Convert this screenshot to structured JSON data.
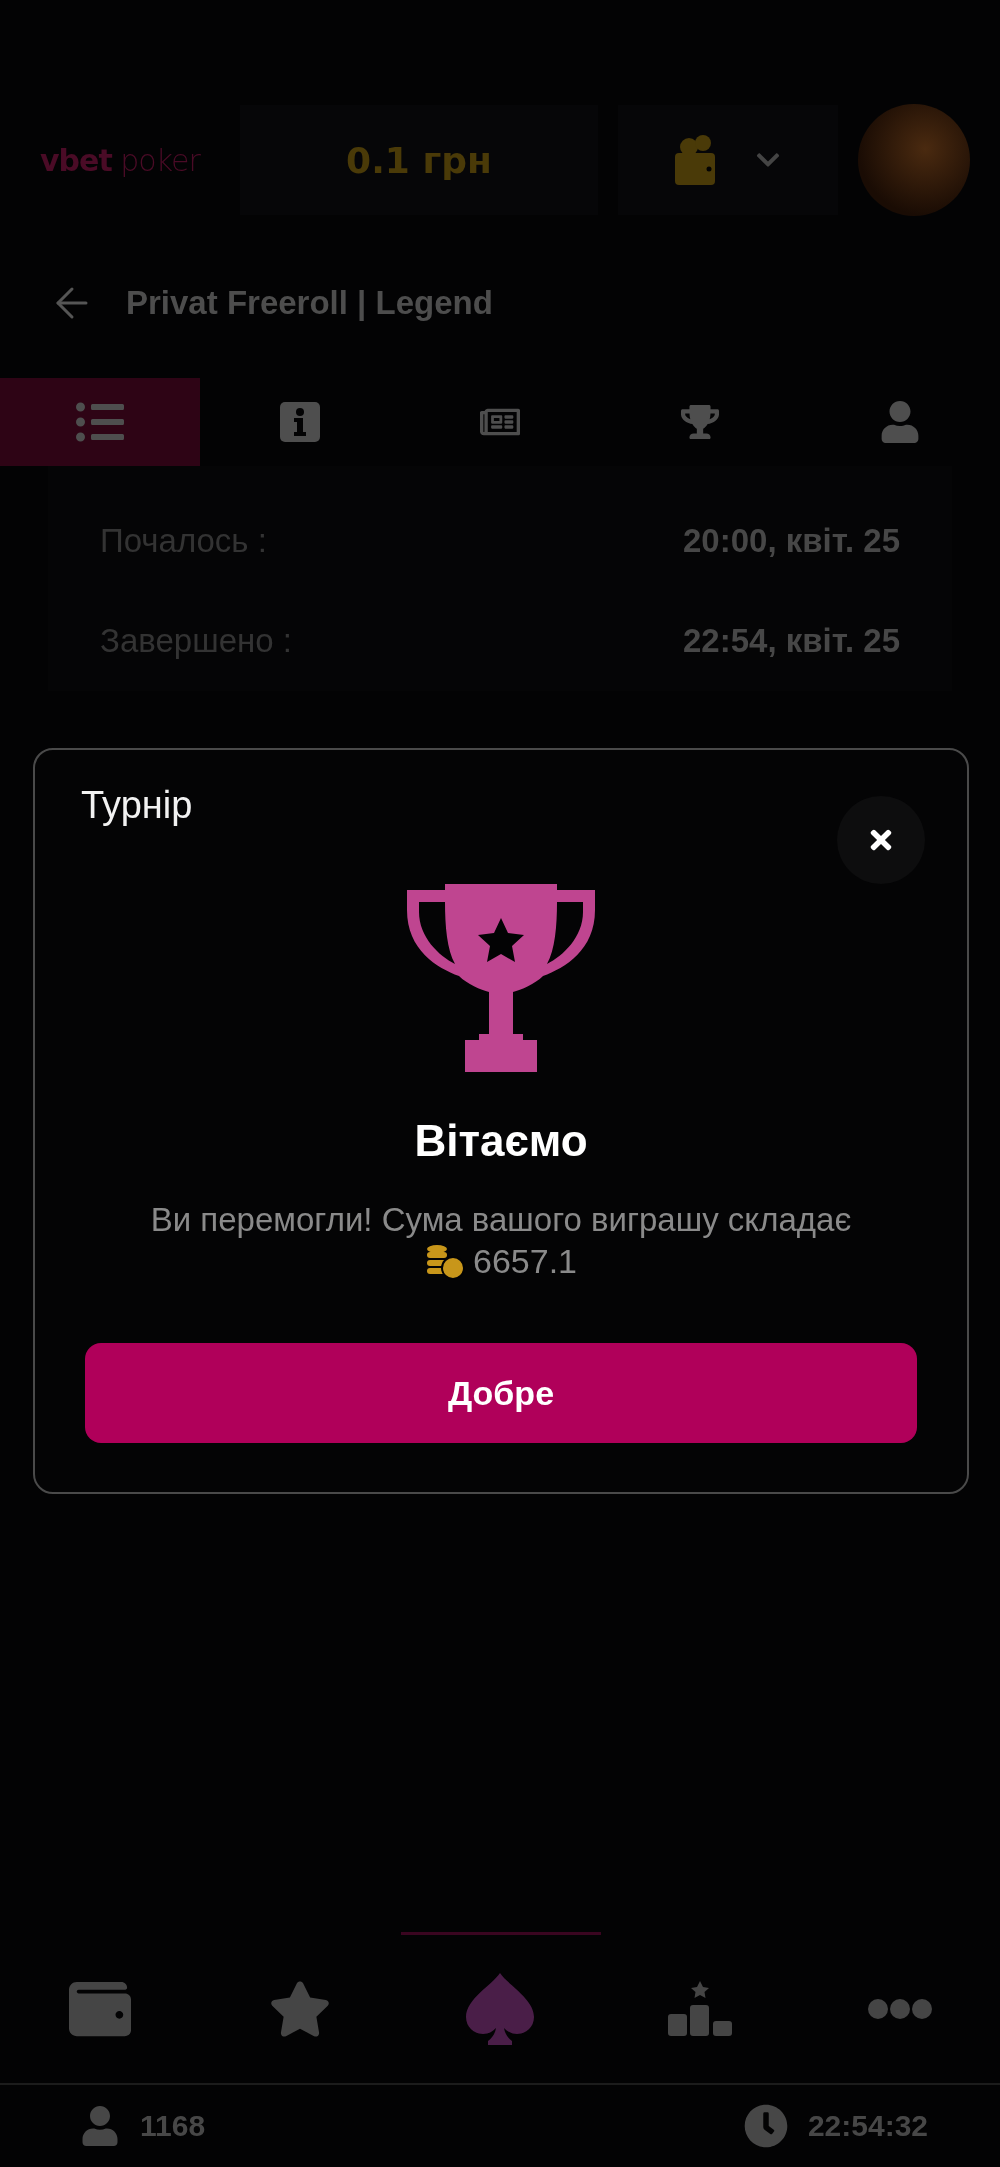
{
  "header": {
    "logo": {
      "brand": "vbet",
      "product": "poker"
    },
    "balance": "0.1 грн"
  },
  "page_title": "Privat Freeroll | Legend",
  "tabs": [
    {
      "kind": "list",
      "selected": true
    },
    {
      "kind": "info",
      "selected": false
    },
    {
      "kind": "card",
      "selected": false
    },
    {
      "kind": "trophy",
      "selected": false
    },
    {
      "kind": "user",
      "selected": false
    }
  ],
  "info_rows": [
    {
      "label": "Почалось :",
      "value": "20:00, квіт. 25"
    },
    {
      "label": "Завершено :",
      "value": "22:54, квіт. 25"
    }
  ],
  "modal": {
    "title": "Турнір",
    "heading": "Вітаємо",
    "message": "Ви перемогли! Сума вашого виграшу складає",
    "amount": "6657.1",
    "button": "Добре"
  },
  "bottom_nav": [
    {
      "kind": "wallet",
      "selected": false
    },
    {
      "kind": "star",
      "selected": false
    },
    {
      "kind": "spade",
      "selected": true
    },
    {
      "kind": "podium",
      "selected": false
    },
    {
      "kind": "more",
      "selected": false
    }
  ],
  "status_bar": {
    "players": "1168",
    "time": "22:54:32"
  }
}
